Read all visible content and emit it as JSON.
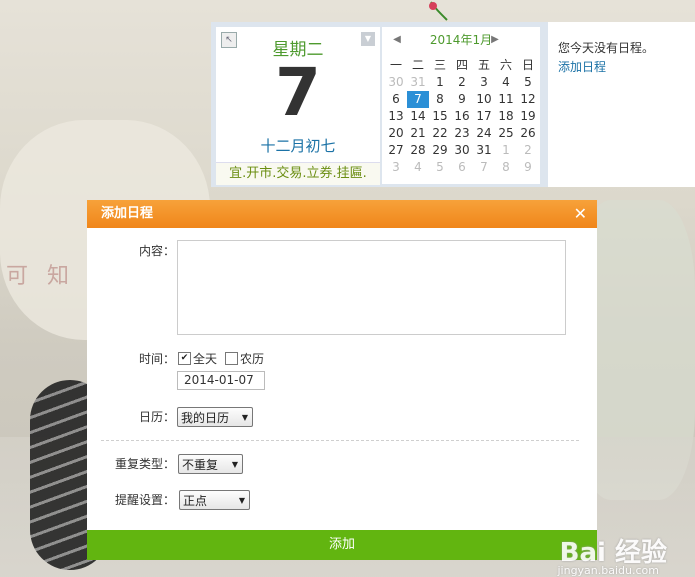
{
  "background": {
    "decor_text": "可 知 道"
  },
  "calendar": {
    "weekday": "星期二",
    "day": "7",
    "lunar": "十二月初七",
    "yiji": "宜.开市.交易.立券.挂匾.",
    "month_title": "2014年1月",
    "week_headers": [
      "一",
      "二",
      "三",
      "四",
      "五",
      "六",
      "日"
    ],
    "weeks": [
      [
        "30",
        "31",
        "1",
        "2",
        "3",
        "4",
        "5"
      ],
      [
        "6",
        "7",
        "8",
        "9",
        "10",
        "11",
        "12"
      ],
      [
        "13",
        "14",
        "15",
        "16",
        "17",
        "18",
        "19"
      ],
      [
        "20",
        "21",
        "22",
        "23",
        "24",
        "25",
        "26"
      ],
      [
        "27",
        "28",
        "29",
        "30",
        "31",
        "1",
        "2"
      ],
      [
        "3",
        "4",
        "5",
        "6",
        "7",
        "8",
        "9"
      ]
    ],
    "no_event_text": "您今天没有日程。",
    "add_link": "添加日程"
  },
  "dialog": {
    "title": "添加日程",
    "close": "✕",
    "content_label": "内容：",
    "time_label": "时间：",
    "allday_label": "全天",
    "lunar_label": "农历",
    "date_value": "2014-01-07",
    "calendar_label": "日历：",
    "calendar_value": "我的日历",
    "repeat_label": "重复类型：",
    "repeat_value": "不重复",
    "remind_label": "提醒设置：",
    "remind_value": "正点",
    "submit": "添加"
  },
  "watermark": {
    "main": "Bai 经验",
    "sub": "jingyan.baidu.com"
  },
  "colors": {
    "accent_orange": "#f0861a",
    "accent_green": "#62b510",
    "select_blue": "#2b8fd6",
    "link_blue": "#1b72a6",
    "lunar_green": "#4e9a2e"
  }
}
